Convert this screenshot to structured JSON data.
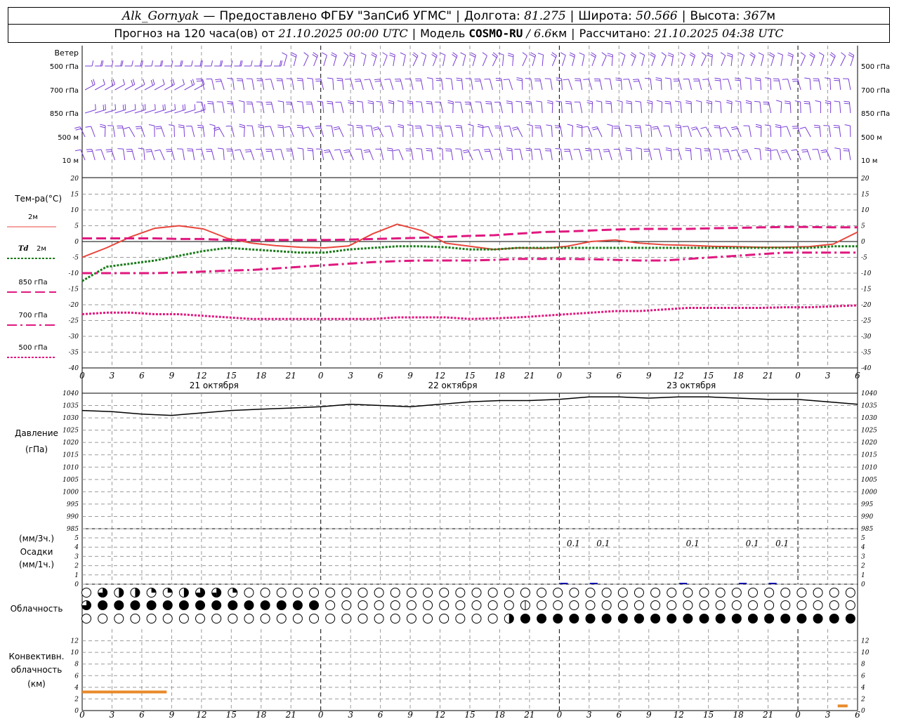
{
  "header": {
    "station": "Alk_Gornyak",
    "dash": "—",
    "provider": "Предоставлено ФГБУ \"ЗапСиб УГМС\"",
    "lon_label": "Долгота:",
    "lon_value": "81.275",
    "lat_label": "Широта:",
    "lat_value": "50.566",
    "alt_label": "Высота:",
    "alt_value": "367",
    "alt_unit": "м",
    "forecast_prefix": "Прогноз на 120 часа(ов) от",
    "forecast_time": "21.10.2025 00:00 UTC",
    "model_label": "Модель",
    "model_name": "COSMO-RU",
    "model_res": "/ 6.6",
    "model_res_unit": "км",
    "computed_label": "Рассчитано:",
    "computed_time": "21.10.2025 04:38 UTC"
  },
  "colors": {
    "wind": "#7a3dd6",
    "t2m": "#e8463c",
    "td2m": "#1a7a1a",
    "t850": "#e0187f",
    "t700": "#e0187f",
    "t500": "#e0187f",
    "pressure": "#000000",
    "convective": "#e88a2a",
    "precip": "#0000aa",
    "grid": "#9a9a9a"
  },
  "labels": {
    "wind_title": "Ветер",
    "wind_levels": [
      "500 гПа",
      "700 гПа",
      "850 гПа",
      "500 м",
      "10  м"
    ],
    "temp_title": "Тем-ра(°C)",
    "legend": [
      {
        "key": "t2m",
        "text": "2м"
      },
      {
        "key": "td2m",
        "text_a": "Td",
        "text_b": "2м"
      },
      {
        "key": "t850",
        "text": "850 гПа"
      },
      {
        "key": "t700",
        "text": "700 гПа"
      },
      {
        "key": "t500",
        "text": "500 гПа"
      }
    ],
    "pressure_title": "Давление",
    "pressure_unit": "(гПа)",
    "precip_unit3": "(мм/3ч.)",
    "precip_title": "Осадки",
    "precip_unit1": "(мм/1ч.)",
    "cloud_title": "Облачность",
    "conv_title1": "Конвективн.",
    "conv_title2": "облачность",
    "conv_unit": "(км)"
  },
  "chart_data": {
    "type": "line",
    "x_hours": [
      0,
      3,
      6,
      9,
      12,
      15,
      18,
      21,
      24,
      27,
      30,
      33,
      36,
      39,
      42,
      45,
      48,
      51,
      54,
      57,
      60,
      63,
      66,
      69,
      72,
      75,
      78
    ],
    "x_tick_labels": [
      "0",
      "3",
      "6",
      "9",
      "12",
      "15",
      "18",
      "21",
      "0",
      "3",
      "6",
      "9",
      "12",
      "15",
      "18",
      "21",
      "0",
      "3",
      "6",
      "9",
      "12",
      "15",
      "18",
      "21",
      "0",
      "3",
      "6"
    ],
    "day_labels": [
      {
        "hour": 12,
        "text": "21 октября"
      },
      {
        "hour": 36,
        "text": "22 октября"
      },
      {
        "hour": 60,
        "text": "23 октября"
      }
    ],
    "temperature": {
      "ylim": [
        -40,
        20
      ],
      "yticks": [
        20,
        15,
        10,
        5,
        0,
        -5,
        -10,
        -15,
        -20,
        -25,
        -30,
        -35,
        -40
      ],
      "series": [
        {
          "key": "t2m",
          "name": "2м",
          "style": "solid",
          "values": [
            -5,
            -2,
            1.5,
            4.2,
            5,
            4,
            1,
            -0.5,
            -1.3,
            -1.8,
            -2,
            -1.4,
            2.5,
            5.5,
            3.5,
            -0.5,
            -1.5,
            -2.5,
            -2,
            -2.2,
            -1.5,
            0,
            0.5,
            -0.5,
            -1,
            -1.2,
            -1.5,
            -1.6,
            -1.8,
            -1.8,
            -1.6,
            -0.8,
            3
          ]
        },
        {
          "key": "td2m",
          "name": "Td 2м",
          "style": "dotted",
          "values": [
            -12.5,
            -8,
            -7,
            -6,
            -4.5,
            -3,
            -2,
            -2.5,
            -3,
            -3.5,
            -3.5,
            -2.5,
            -2,
            -1.5,
            -1.5,
            -1.8,
            -2.5,
            -2.5,
            -2,
            -2,
            -2,
            -2,
            -2,
            -2,
            -2,
            -2,
            -2,
            -2,
            -2,
            -2,
            -2,
            -1.5,
            -1.5
          ]
        },
        {
          "key": "t850",
          "name": "850 гПа",
          "style": "long-dash",
          "values": [
            1,
            1,
            1,
            1,
            0.8,
            0.8,
            0.5,
            0.5,
            0.5,
            0.5,
            0.5,
            0.6,
            0.8,
            1,
            1.2,
            1.5,
            1.8,
            2,
            2.5,
            3,
            3.2,
            3.5,
            3.8,
            4,
            4,
            4,
            4.2,
            4.3,
            4.5,
            4.6,
            4.6,
            4.5,
            4.5
          ]
        },
        {
          "key": "t700",
          "name": "700 гПа",
          "style": "dash-dot",
          "values": [
            -10,
            -10,
            -10,
            -10,
            -9.8,
            -9.5,
            -9.2,
            -9,
            -8.5,
            -8,
            -7.5,
            -7,
            -6.5,
            -6.2,
            -6,
            -6,
            -6,
            -5.8,
            -5.5,
            -5.5,
            -5.5,
            -5.6,
            -5.8,
            -6,
            -6,
            -5.5,
            -5,
            -4.5,
            -4,
            -3.5,
            -3.5,
            -3.5,
            -3.5
          ]
        },
        {
          "key": "t500",
          "name": "500 гПа",
          "style": "dotted",
          "values": [
            -23,
            -22.5,
            -22.5,
            -23,
            -23,
            -23.5,
            -24,
            -24.5,
            -24.5,
            -24.5,
            -24.5,
            -24.5,
            -24.5,
            -24,
            -24,
            -24,
            -24.5,
            -24.3,
            -24,
            -23.5,
            -23,
            -22.5,
            -22,
            -22,
            -21.5,
            -21,
            -21,
            -21,
            -21,
            -20.8,
            -20.8,
            -20.5,
            -20.2
          ]
        }
      ]
    },
    "pressure": {
      "ylim": [
        985,
        1040
      ],
      "yticks": [
        1040,
        1035,
        1030,
        1025,
        1020,
        1015,
        1010,
        1005,
        1000,
        995,
        990,
        985
      ],
      "values": [
        1033,
        1032.5,
        1031.5,
        1031,
        1032,
        1033,
        1033.5,
        1034,
        1034.5,
        1035.5,
        1035,
        1034.5,
        1035.5,
        1036.5,
        1037,
        1037,
        1037.5,
        1038.5,
        1038.5,
        1038,
        1038.5,
        1038.5,
        1038,
        1037.5,
        1037.5,
        1036.5,
        1035.5
      ]
    },
    "precipitation": {
      "ylim": [
        0,
        5
      ],
      "yticks": [
        5,
        4,
        3,
        2,
        1,
        0
      ],
      "labels": [
        {
          "hour": 48,
          "text": "0.1"
        },
        {
          "hour": 51,
          "text": "0.1"
        },
        {
          "hour": 60,
          "text": "0.1"
        },
        {
          "hour": 66,
          "text": "0.1"
        },
        {
          "hour": 69,
          "text": "0.1"
        }
      ]
    },
    "clouds": {
      "rows": 3,
      "cols": 48,
      "row0_partial": [
        [
          1,
          "0.75"
        ],
        [
          2,
          "0.5"
        ],
        [
          3,
          "0.5"
        ],
        [
          4,
          "0.25"
        ],
        [
          5,
          "0.25"
        ],
        [
          6,
          "0.5"
        ],
        [
          7,
          "0.75"
        ],
        [
          8,
          "0.75"
        ],
        [
          9,
          "0.25"
        ]
      ],
      "row1_full_range": [
        1,
        14
      ],
      "row1_partial": [
        [
          0,
          "0.75"
        ],
        [
          27,
          "0.1"
        ]
      ],
      "row2_full_range": [
        27,
        47
      ],
      "row2_partial": [
        [
          26,
          "0.5"
        ]
      ]
    },
    "convective": {
      "ylim": [
        0,
        14
      ],
      "yticks": [
        12,
        10,
        8,
        6,
        4,
        2,
        0
      ],
      "segments": [
        {
          "from_hour": 0,
          "to_hour": 8.5,
          "value": 3.2
        },
        {
          "from_hour": 76,
          "to_hour": 77,
          "value": 0.8
        }
      ]
    }
  }
}
